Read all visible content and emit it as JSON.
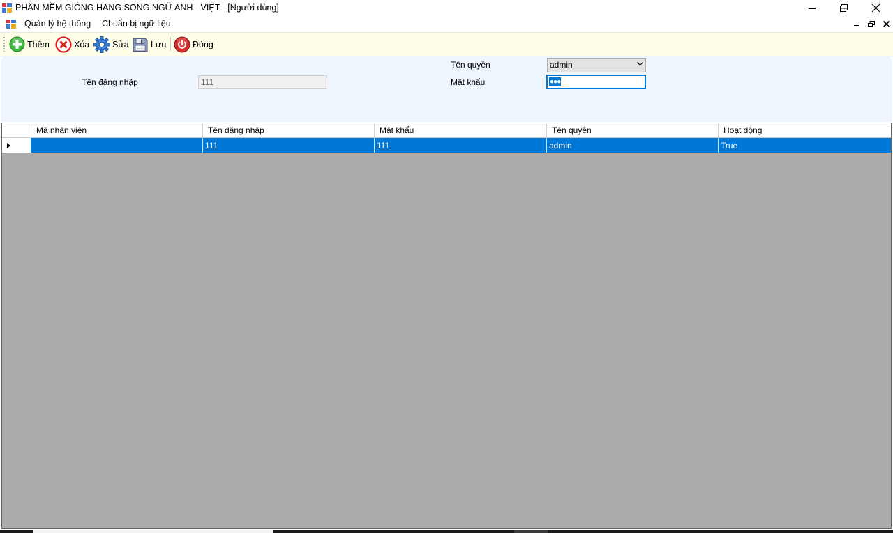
{
  "window": {
    "title": "PHẦN MỀM GIÓNG HÀNG SONG NGỮ ANH - VIỆT - [Người dùng]",
    "icons": [
      "app-icon",
      "minimize-icon",
      "restore-icon",
      "close-icon"
    ]
  },
  "menu": {
    "items": [
      {
        "label": "Quản lý hệ thống"
      },
      {
        "label": "Chuẩn bị ngữ liệu"
      }
    ]
  },
  "toolbar": {
    "buttons": [
      {
        "label": "Thêm",
        "icon": "add-icon",
        "color": "#2fa82f"
      },
      {
        "label": "Xóa",
        "icon": "delete-icon",
        "color": "#d81e1e"
      },
      {
        "label": "Sửa",
        "icon": "gear-icon",
        "color": "#3a7bd5"
      },
      {
        "label": "Lưu",
        "icon": "save-icon",
        "color": "#6b7fa8"
      },
      {
        "label": "Đóng",
        "icon": "power-icon",
        "color": "#d32f2f"
      }
    ]
  },
  "form": {
    "username_label": "Tên đăng nhập",
    "username_value": "111",
    "role_label": "Tên quyền",
    "role_value": "admin",
    "password_label": "Mật khẩu",
    "password_value": "●●●"
  },
  "grid": {
    "columns": [
      "Mã nhân viên",
      "Tên đăng nhập",
      "Mật khẩu",
      "Tên quyền",
      "Hoạt động"
    ],
    "rows": [
      {
        "ma_nhan_vien": "",
        "ten_dang_nhap": "111",
        "mat_khau": "111",
        "ten_quyen": "admin",
        "hoat_dong": "True",
        "selected": true
      }
    ],
    "selection_color": "#0078d7",
    "background_color": "#ababab"
  }
}
